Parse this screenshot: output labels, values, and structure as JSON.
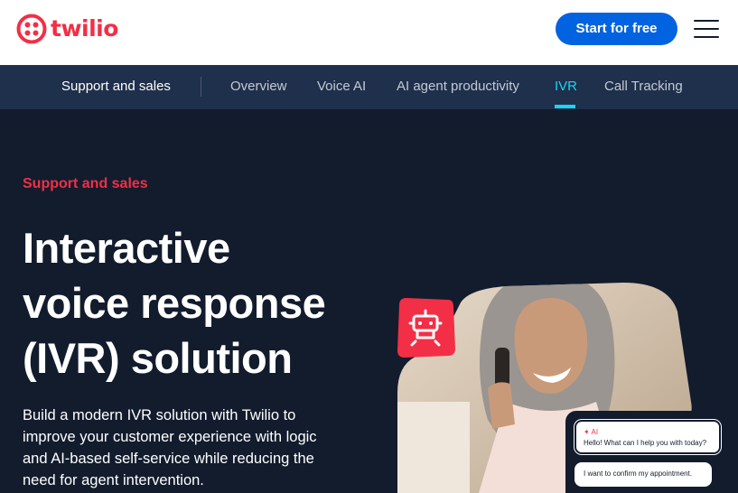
{
  "brand": {
    "name": "twilio",
    "color": "#f22f46"
  },
  "header": {
    "cta_label": "Start for free",
    "menu_icon": "hamburger-menu-icon"
  },
  "subnav": {
    "title": "Support and sales",
    "links": [
      "Overview",
      "Voice AI",
      "AI agent productivity",
      "IVR",
      "Call Tracking"
    ],
    "active": "IVR"
  },
  "hero": {
    "eyebrow": "Support and sales",
    "headline_lines": [
      "Interactive",
      "voice response",
      "(IVR) solution"
    ],
    "body_lines": [
      "Build a modern IVR solution with Twilio to",
      "improve your customer experience with logic",
      "and AI-based self-service while reducing the",
      "need for agent intervention."
    ]
  },
  "chat": {
    "ai_tag": "AI",
    "ai_message": "Hello! What can I help you with today?",
    "user_message": "I want to confirm my appointment."
  },
  "colors": {
    "accent": "#0263e0",
    "navy": "#121c2d",
    "subnav": "#1f304c",
    "active_link": "#1bd3f5"
  }
}
